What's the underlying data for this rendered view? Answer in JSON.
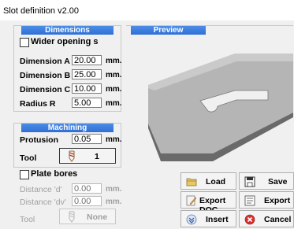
{
  "window": {
    "title": "Slot definition v2.00"
  },
  "dimensions": {
    "header": "Dimensions",
    "wider_opening_label": "Wider opening s",
    "rows": [
      {
        "label": "Dimension A",
        "value": "20.00",
        "unit": "mm."
      },
      {
        "label": "Dimension B",
        "value": "25.00",
        "unit": "mm."
      },
      {
        "label": "Dimension C",
        "value": "10.00",
        "unit": "mm."
      },
      {
        "label": "Radius R",
        "value": "5.00",
        "unit": "mm."
      }
    ]
  },
  "preview": {
    "header": "Preview"
  },
  "machining": {
    "header": "Machining",
    "protusion_label": "Protusion",
    "protusion_value": "0.05",
    "protusion_unit": "mm.",
    "tool_label": "Tool",
    "tool_value": "1",
    "plate_bores_label": "Plate bores",
    "distance_d_label": "Distance 'd'",
    "distance_d_value": "0.00",
    "distance_d_unit": "mm.",
    "distance_dv_label": "Distance 'dv'",
    "distance_dv_value": "0.00",
    "distance_dv_unit": "mm.",
    "tool2_label": "Tool",
    "tool2_value": "None"
  },
  "buttons": {
    "load": "Load",
    "save": "Save",
    "export_doc": "Export DOC",
    "export": "Export",
    "insert": "Insert",
    "cancel": "Cancel"
  }
}
